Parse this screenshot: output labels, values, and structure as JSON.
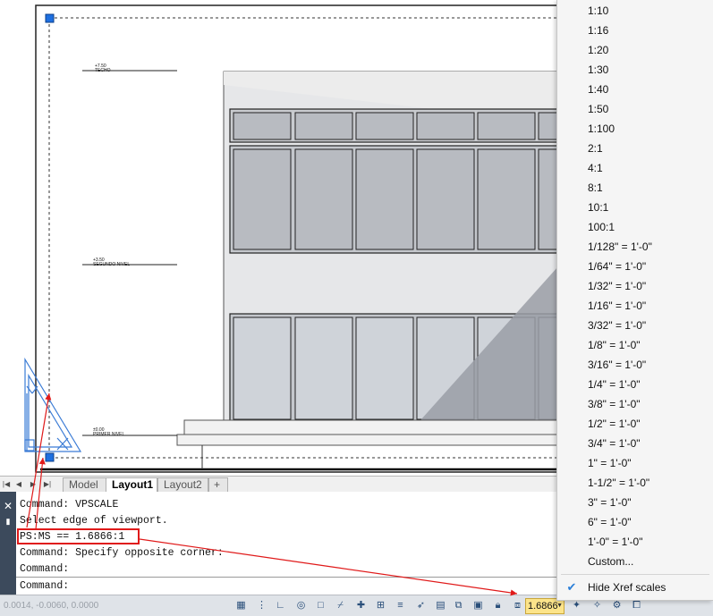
{
  "drawing": {
    "levels": [
      {
        "elevation": "+7.50",
        "name": "TECHO"
      },
      {
        "elevation": "+3.50",
        "name": "SEGUNDO NIVEL"
      },
      {
        "elevation": "±0.00",
        "name": "PRIMER NIVEL"
      }
    ]
  },
  "tabs": {
    "nav": [
      "|◀",
      "◀",
      "▶",
      "▶|"
    ],
    "items": [
      {
        "label": "Model",
        "active": false
      },
      {
        "label": "Layout1",
        "active": true
      },
      {
        "label": "Layout2",
        "active": false
      }
    ],
    "add_label": "+"
  },
  "command_window": {
    "history": [
      "Command: VPSCALE",
      "Select edge of viewport.",
      "PS:MS == 1.6866:1",
      "Command: Specify opposite corner:",
      "Command:"
    ],
    "prompt": "Command:",
    "input_value": "",
    "close_glyph": "✕",
    "pin_glyph": "📌"
  },
  "status_bar": {
    "coordinates": "0.0014, -0.0060, 0.0000",
    "scale_value": "1.6866",
    "icons": [
      "grid-icon",
      "snap-icon",
      "ortho-icon",
      "polar-icon",
      "osnap-icon",
      "otrack-icon",
      "ucs-icon",
      "dyn-icon",
      "lineweight-icon",
      "transparency-icon",
      "selection-cycling-icon",
      "3d-osnap-icon",
      "dynamic-ucs-icon",
      "selection-filter-icon",
      "gizmo-icon",
      "lock-icon",
      "annotation-scale-icon",
      "annotation-visibility-icon",
      "auto-scale-icon",
      "workspace-icon"
    ]
  },
  "scale_menu": {
    "items": [
      "1:10",
      "1:16",
      "1:20",
      "1:30",
      "1:40",
      "1:50",
      "1:100",
      "2:1",
      "4:1",
      "8:1",
      "10:1",
      "100:1",
      "1/128\" = 1'-0\"",
      "1/64\" = 1'-0\"",
      "1/32\" = 1'-0\"",
      "1/16\" = 1'-0\"",
      "3/32\" = 1'-0\"",
      "1/8\" = 1'-0\"",
      "3/16\" = 1'-0\"",
      "1/4\" = 1'-0\"",
      "3/8\" = 1'-0\"",
      "1/2\" = 1'-0\"",
      "3/4\" = 1'-0\"",
      "1\" = 1'-0\"",
      "1-1/2\" = 1'-0\"",
      "3\" = 1'-0\"",
      "6\" = 1'-0\"",
      "1'-0\" = 1'-0\"",
      "Custom..."
    ],
    "hide_xref_label": "Hide Xref scales",
    "hide_xref_checked": true
  },
  "colors": {
    "accent_blue": "#2b7fd8",
    "annotation_red": "#e01a1a",
    "scale_highlight": "#fce48a",
    "command_sidebar": "#3c4a5c"
  }
}
